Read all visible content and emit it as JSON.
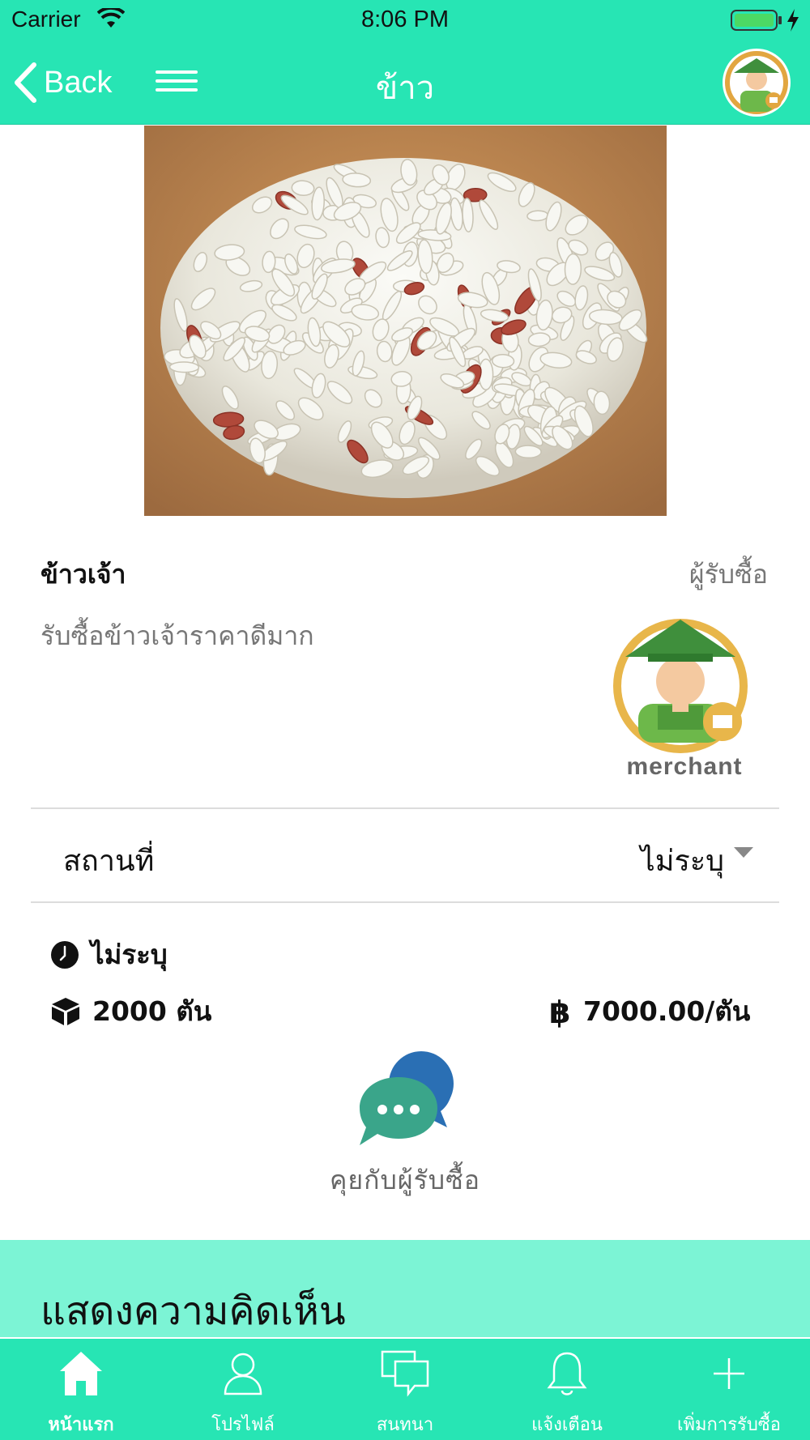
{
  "status_bar": {
    "carrier": "Carrier",
    "time": "8:06 PM"
  },
  "nav": {
    "back_label": "Back",
    "title": "ข้าว"
  },
  "product": {
    "name": "ข้าวเจ้า",
    "role": "ผู้รับซื้อ",
    "description": "รับซื้อข้าวเจ้าราคาดีมาก",
    "merchant_name": "merchant"
  },
  "location": {
    "label": "สถานที่",
    "value": "ไม่ระบุ"
  },
  "details": {
    "time_value": "ไม่ระบุ",
    "quantity": "2000 ตัน",
    "price": "7000.00/ตัน"
  },
  "chat": {
    "label": "คุยกับผู้รับซื้อ"
  },
  "comments": {
    "title": "แสดงความคิดเห็น"
  },
  "tabs": [
    {
      "label": "หน้าแรก",
      "icon": "home-icon",
      "active": true
    },
    {
      "label": "โปรไฟล์",
      "icon": "profile-icon",
      "active": false
    },
    {
      "label": "สนทนา",
      "icon": "chat-bubbles-icon",
      "active": false
    },
    {
      "label": "แจ้งเตือน",
      "icon": "bell-icon",
      "active": false
    },
    {
      "label": "เพิ่มการรับซื้อ",
      "icon": "plus-icon",
      "active": false
    }
  ],
  "colors": {
    "brand": "#27e5b4",
    "comment_bg": "#7cf4d5",
    "chat_front": "#3aa58a",
    "chat_back": "#2a6fb4"
  }
}
